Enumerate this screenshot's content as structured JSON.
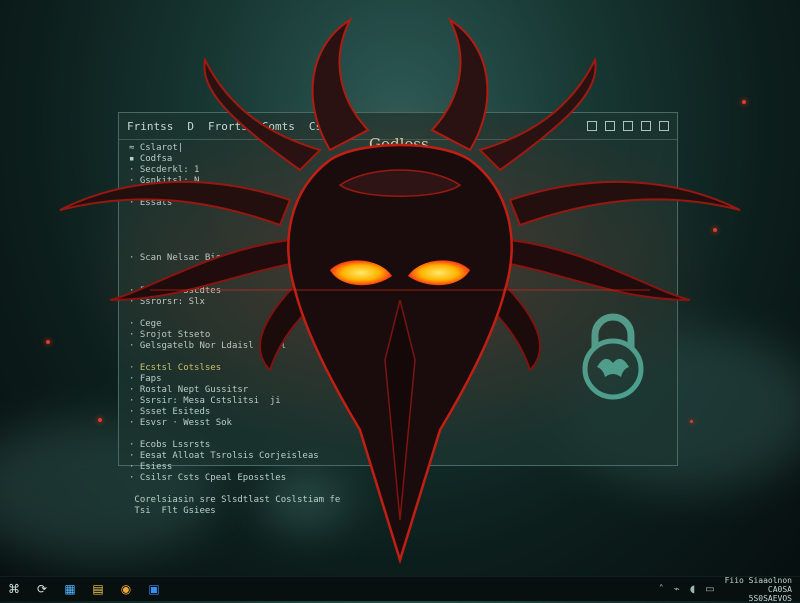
{
  "window": {
    "menu": [
      "Frintss",
      "D",
      "Frorts",
      "Comts",
      "Csislads"
    ],
    "title": "Godless",
    "code_lines": [
      {
        "mark": "≈",
        "text": "Cslarot|",
        "hi": false
      },
      {
        "mark": "▪",
        "text": "Codfsa",
        "hi": false
      },
      {
        "mark": "·",
        "text": "Secderkl: 1",
        "hi": false
      },
      {
        "mark": "·",
        "text": "Gsnkitsl: N",
        "hi": false
      },
      {
        "mark": "·",
        "text": "Ssiltgs",
        "hi": false
      },
      {
        "mark": "·",
        "text": "Essats",
        "hi": false
      },
      {
        "mark": "",
        "text": "",
        "hi": false
      },
      {
        "mark": "",
        "text": "",
        "hi": false
      },
      {
        "mark": "",
        "text": "",
        "hi": false
      },
      {
        "mark": "",
        "text": "",
        "hi": false
      },
      {
        "mark": "·",
        "text": "Scan Nelsac Biss:",
        "hi": false
      },
      {
        "mark": "",
        "text": "",
        "hi": false
      },
      {
        "mark": "",
        "text": "",
        "hi": false
      },
      {
        "mark": "·",
        "text": "Fsrotr: Sscdtes",
        "hi": false
      },
      {
        "mark": "·",
        "text": "Ssrorsr: Slx",
        "hi": false
      },
      {
        "mark": "",
        "text": "",
        "hi": false
      },
      {
        "mark": "·",
        "text": "Cege",
        "hi": false
      },
      {
        "mark": "·",
        "text": "Srojot Stseto",
        "hi": false
      },
      {
        "mark": "·",
        "text": "Gelsgatelb Nor Ldaisl Sroil",
        "hi": false
      },
      {
        "mark": "",
        "text": "",
        "hi": false
      },
      {
        "mark": "·",
        "text": "Ecstsl Cotslses",
        "hi": true
      },
      {
        "mark": "·",
        "text": "Faps",
        "hi": false
      },
      {
        "mark": "·",
        "text": "Rostal Nept Gussitsr",
        "hi": false
      },
      {
        "mark": "·",
        "text": "Ssrsir: Mesa Cstslitsi  ji",
        "hi": false
      },
      {
        "mark": "·",
        "text": "Ssset Esiteds",
        "hi": false
      },
      {
        "mark": "·",
        "text": "Esvsr · Wesst Sok",
        "hi": false
      },
      {
        "mark": "",
        "text": "",
        "hi": false
      },
      {
        "mark": "·",
        "text": "Ecobs Lssrsts",
        "hi": false
      },
      {
        "mark": "·",
        "text": "Eesat Alloat Tsrolsis Corjeisleas",
        "hi": false
      },
      {
        "mark": "·",
        "text": "Esiess",
        "hi": false
      },
      {
        "mark": "·",
        "text": "Csilsr Csts Cpeal Eposstles",
        "hi": false
      },
      {
        "mark": "",
        "text": "",
        "hi": false
      },
      {
        "mark": "",
        "text": "Corelsiasin sre Slsdtlast Coslstiam fe",
        "hi": false
      },
      {
        "mark": "",
        "text": "Tsi  Flt Gsiees",
        "hi": false
      }
    ]
  },
  "icons": {
    "lock": "padlock-icon",
    "demon": "demon-mask-icon"
  },
  "taskbar": {
    "start": "⌘",
    "search": "⟳",
    "apps": [
      "▦",
      "▤",
      "◉",
      "▣"
    ],
    "tray_up": "˄",
    "tray_net": "⌁",
    "tray_vol": "◖",
    "tray_bat": "▭",
    "clock_line1": "Fiio Siaaolnon",
    "clock_line2": "CA0SA",
    "clock_line3": "5S0SAEVOS"
  },
  "colors": {
    "eyes": "#ffd21a",
    "eye_glow": "#ff2a12",
    "horn": "#2a1212"
  }
}
